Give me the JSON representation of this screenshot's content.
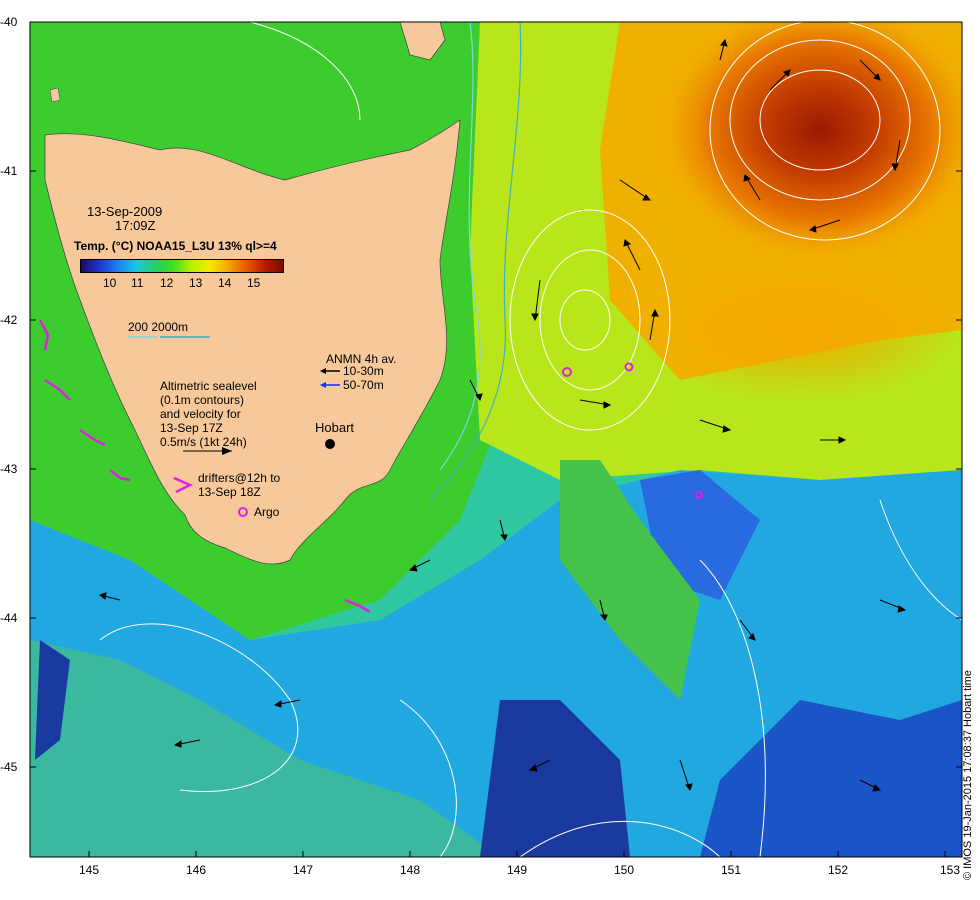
{
  "date": "13-Sep-2009",
  "time": "17:09Z",
  "colorbar_title": "Temp. (°C) NOAA15_L3U 13% ql>=4",
  "colorbar_ticks": [
    "10",
    "11",
    "12",
    "13",
    "14",
    "15"
  ],
  "isobath_label": "200  2000m",
  "mooring_title": "ANMN 4h av.",
  "mooring_shallow": "10-30m",
  "mooring_deep": "50-70m",
  "altimetry_lines": [
    "Altimetric sealevel",
    "(0.1m contours)",
    "and velocity for",
    "13-Sep 17Z",
    "0.5m/s (1kt 24h)"
  ],
  "place_label": "Hobart",
  "drifters_lines": [
    "drifters@12h to",
    "13-Sep 18Z"
  ],
  "argo_label": "Argo",
  "credit": "© IMOS 19-Jan-2015 17:08:37 Hobart time",
  "x_ticks": [
    "145",
    "146",
    "147",
    "148",
    "149",
    "150",
    "151",
    "152",
    "153"
  ],
  "y_ticks": [
    "-40",
    "-41",
    "-42",
    "-43",
    "-44",
    "-45"
  ],
  "colors": {
    "land": "#f7c99a",
    "contour": "#ffffff",
    "isobath_200": "#7fd8d8",
    "isobath_2000": "#40b0c0",
    "drifter": "#e020e0",
    "argo": "#e020e0",
    "mooring_deep": "#1030ff"
  }
}
